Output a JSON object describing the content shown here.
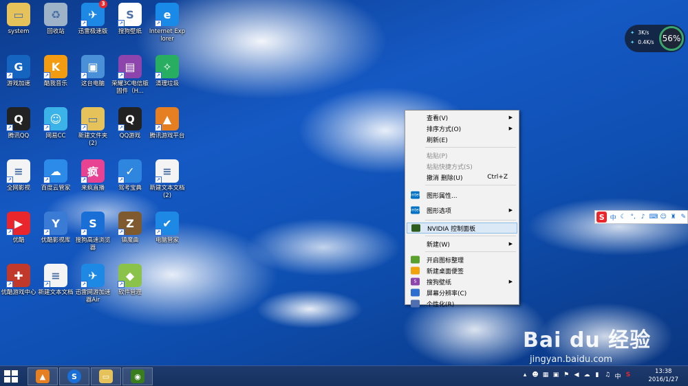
{
  "desktop_icons": [
    {
      "label": "system",
      "icon": "folder-icon",
      "color": "#e6c25a"
    },
    {
      "label": "回收站",
      "icon": "recycle-bin-icon",
      "color": "#9fb3c8"
    },
    {
      "label": "迅雷极速版",
      "icon": "xunlei-icon",
      "color": "#1e88e5",
      "badge": "3"
    },
    {
      "label": "搜狗壁纸",
      "icon": "sogou-wallpaper-icon",
      "color": "#ffffff"
    },
    {
      "label": "Internet Explorer",
      "icon": "ie-icon",
      "color": "#1a8ae8"
    },
    {
      "label": "游戏加速",
      "icon": "game-accelerator-icon",
      "color": "#1565c0"
    },
    {
      "label": "酷我音乐",
      "icon": "kuwo-music-icon",
      "color": "#f39c12"
    },
    {
      "label": "这台电脑",
      "icon": "computer-icon",
      "color": "#4a90d9"
    },
    {
      "label": "荣耀3C电信版固件（H...",
      "icon": "archive-icon",
      "color": "#8e44ad"
    },
    {
      "label": "清理垃圾",
      "icon": "cleaner-icon",
      "color": "#27ae60"
    },
    {
      "label": "腾讯QQ",
      "icon": "qq-icon",
      "color": "#222222"
    },
    {
      "label": "网易CC",
      "icon": "netease-cc-icon",
      "color": "#3bb3e8"
    },
    {
      "label": "新建文件夹(2)",
      "icon": "folder-icon",
      "color": "#e6c25a"
    },
    {
      "label": "QQ游戏",
      "icon": "qq-game-icon",
      "color": "#222222"
    },
    {
      "label": "腾讯游戏平台",
      "icon": "tencent-game-icon",
      "color": "#e67e22"
    },
    {
      "label": "全网影视",
      "icon": "document-icon",
      "color": "#f4f4f4"
    },
    {
      "label": "百度云管家",
      "icon": "baidu-cloud-icon",
      "color": "#2c8ae8"
    },
    {
      "label": "来疯直播",
      "icon": "laifeng-icon",
      "color": "#e84393"
    },
    {
      "label": "驾考宝典",
      "icon": "driving-test-icon",
      "color": "#2e86de"
    },
    {
      "label": "新建文本文档 (2)",
      "icon": "document-icon",
      "color": "#f4f4f4"
    },
    {
      "label": "优酷",
      "icon": "youku-icon",
      "color": "#e8262b"
    },
    {
      "label": "优酷影视库",
      "icon": "youku-library-icon",
      "color": "#3a7bd5"
    },
    {
      "label": "搜狗高速浏览器",
      "icon": "sogou-browser-icon",
      "color": "#1a6fd6"
    },
    {
      "label": "镇魔曲",
      "icon": "zhenmoqu-icon",
      "color": "#7f5a2e"
    },
    {
      "label": "电脑管家",
      "icon": "pc-manager-icon",
      "color": "#1e88e5"
    },
    {
      "label": "优酷游戏中心",
      "icon": "youku-game-icon",
      "color": "#c0392b"
    },
    {
      "label": "新建文本文档",
      "icon": "document-icon",
      "color": "#f4f4f4"
    },
    {
      "label": "迅雷网游加速器Air",
      "icon": "xunlei-air-icon",
      "color": "#1e88e5"
    },
    {
      "label": "软件管理",
      "icon": "software-manager-icon",
      "color": "#8bc34a"
    }
  ],
  "context_menu": {
    "items": [
      {
        "label": "查看(V)",
        "submenu": true
      },
      {
        "label": "排序方式(O)",
        "submenu": true
      },
      {
        "label": "刷新(E)"
      },
      {
        "separator": true
      },
      {
        "label": "粘贴(P)",
        "disabled": true
      },
      {
        "label": "粘贴快捷方式(S)",
        "disabled": true
      },
      {
        "label": "撤消 删除(U)",
        "shortcut": "Ctrl+Z"
      },
      {
        "separator": true
      },
      {
        "label": "图形属性...",
        "icon": "intel-icon",
        "icon_text": "intel",
        "icon_color": "#0071c5",
        "tall": true
      },
      {
        "label": "图形选项",
        "icon": "intel-icon",
        "icon_text": "intel",
        "icon_color": "#0071c5",
        "submenu": true,
        "tall": true
      },
      {
        "separator": true
      },
      {
        "label": "NVIDIA 控制面板",
        "icon": "nvidia-icon",
        "icon_text": "",
        "icon_color": "#2d5d1f",
        "highlight": true
      },
      {
        "separator": true
      },
      {
        "label": "新建(W)",
        "submenu": true
      },
      {
        "separator": true
      },
      {
        "label": "开启图标整理",
        "icon": "grid-icon",
        "icon_text": "",
        "icon_color": "#5aa02c"
      },
      {
        "label": "新建桌面便签",
        "icon": "note-icon",
        "icon_text": "",
        "icon_color": "#f0a30a"
      },
      {
        "label": "搜狗壁纸",
        "icon": "sogou-icon",
        "icon_text": "S",
        "icon_color": "#8e44ad",
        "submenu": true
      },
      {
        "label": "屏幕分辨率(C)",
        "icon": "monitor-icon",
        "icon_text": "",
        "icon_color": "#2c6fd1"
      },
      {
        "label": "个性化(R)",
        "icon": "personalize-icon",
        "icon_text": "",
        "icon_color": "#4f6fb0"
      }
    ]
  },
  "net_widget": {
    "up_speed": "3K/s",
    "down_speed": "0.4K/s",
    "usage": "56%"
  },
  "ime_bar": {
    "logo": "S",
    "mode": "中"
  },
  "watermark": {
    "logo": "Bai du 经验",
    "url": "jingyan.baidu.com"
  },
  "taskbar": {
    "clock_time": "13:38",
    "clock_date": "2016/1/27",
    "ime_indicator": "中"
  }
}
